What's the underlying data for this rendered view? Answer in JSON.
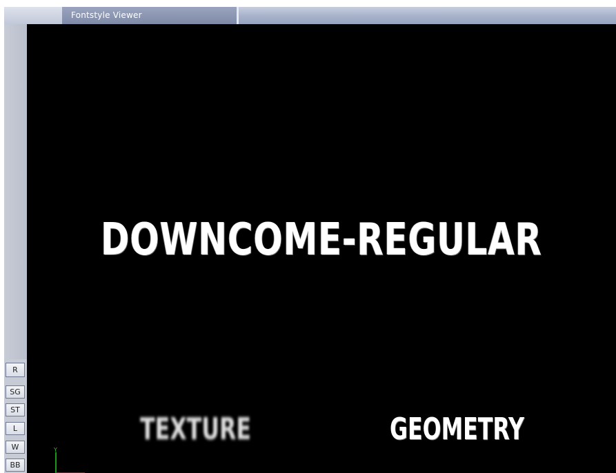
{
  "window": {
    "title": "Fontstyle Viewer"
  },
  "side_buttons": {
    "r": "R",
    "sg": "SG",
    "st": "ST",
    "l": "L",
    "w": "W",
    "bb": "BB"
  },
  "viewport": {
    "background": "#000000",
    "font_name_text": "DOWNCOME-REGULAR",
    "texture_label": "TEXTURE",
    "geometry_label": "GEOMETRY",
    "axis_y_label": "Y",
    "axis_y_color": "#22cc22",
    "axis_x_color": "#cc2222"
  }
}
